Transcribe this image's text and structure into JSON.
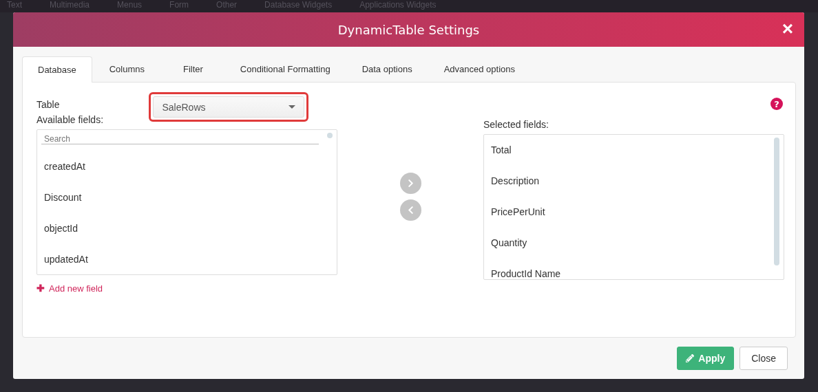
{
  "background_menu": [
    "Text",
    "Multimedia",
    "Menus",
    "Form",
    "Other",
    "Database Widgets",
    "Applications Widgets"
  ],
  "dialog": {
    "title": "DynamicTable Settings",
    "close": "×"
  },
  "tabs": [
    {
      "label": "Database",
      "selected": true
    },
    {
      "label": "Columns",
      "selected": false
    },
    {
      "label": "Filter",
      "selected": false
    },
    {
      "label": "Conditional Formatting",
      "selected": false
    },
    {
      "label": "Data options",
      "selected": false
    },
    {
      "label": "Advanced options",
      "selected": false
    }
  ],
  "table_select": {
    "label": "Table",
    "value": "SaleRows",
    "highlighted": true
  },
  "available": {
    "label": "Available fields:",
    "search_placeholder": "Search",
    "items": [
      "createdAt",
      "Discount",
      "objectId",
      "updatedAt"
    ]
  },
  "selected": {
    "label": "Selected fields:",
    "items": [
      "Total",
      "Description",
      "PricePerUnit",
      "Quantity",
      "ProductId Name"
    ]
  },
  "add_field": {
    "icon": "✚",
    "label": "Add new field"
  },
  "help": "?",
  "buttons": [
    {
      "kind": "primary",
      "label": "Apply"
    },
    {
      "kind": "default",
      "label": "Close"
    }
  ]
}
